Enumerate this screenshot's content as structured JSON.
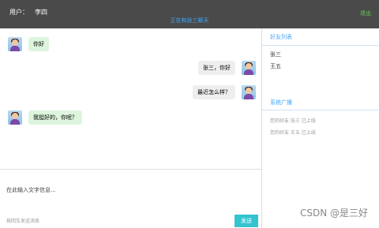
{
  "header": {
    "user_label": "用户：",
    "user_name": "李四",
    "chat_title": "正在和张三聊天",
    "exit_label": "退出"
  },
  "messages": [
    {
      "side": "left",
      "text": "你好"
    },
    {
      "side": "right",
      "text": "张三，你好"
    },
    {
      "side": "right",
      "text": "最近怎么样？"
    },
    {
      "side": "left",
      "text": "我挺好的，你呢？"
    }
  ],
  "input": {
    "placeholder": "在此输入文字信息...",
    "hint": "按回车发送消息",
    "send_label": "发送"
  },
  "sidebar": {
    "friends_title": "好友列表",
    "friends": [
      "张三",
      "王五"
    ],
    "broadcast_title": "系统广播",
    "broadcasts": [
      "您的好友 张三 已上线",
      "您的好友 王五 已上线"
    ]
  },
  "watermark": "CSDN @是三好"
}
